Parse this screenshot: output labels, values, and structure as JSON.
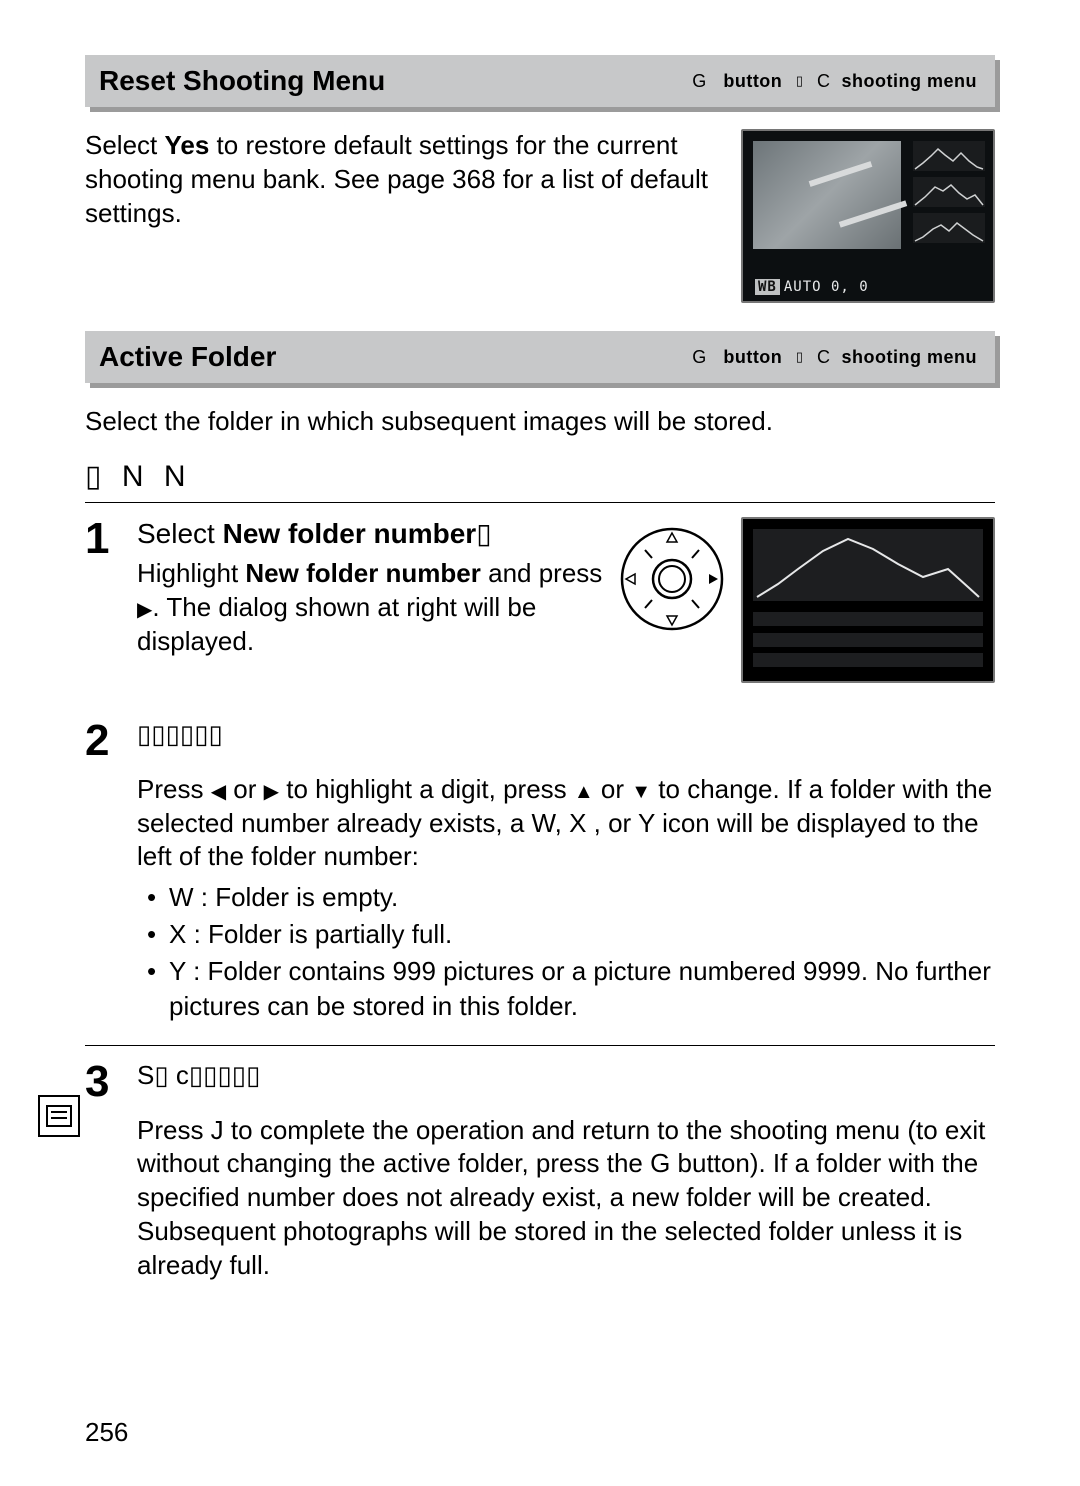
{
  "bar1": {
    "title": "Reset Shooting Menu",
    "crumb_button_glyph": "G",
    "crumb_button_word": "button",
    "crumb_menu_glyph": "C",
    "crumb_menu_word": "shooting menu"
  },
  "reset_desc": {
    "pre": "Select ",
    "yes": "Yes",
    "post": " to restore default settings for the current shooting menu bank.  See page 368 for a list of default settings."
  },
  "thumb1_caption_wb": "WB",
  "thumb1_caption_rest": "AUTO  0,  0",
  "bar2": {
    "title": "Active Folder",
    "crumb_button_glyph": "G",
    "crumb_button_word": "button",
    "crumb_menu_glyph": "C",
    "crumb_menu_word": "shooting menu"
  },
  "active_desc": "Select the folder in which subsequent images will be stored.",
  "nn_line": "▯  N   N",
  "step1": {
    "num": "1",
    "heading_pre": "Select ",
    "heading_bold": " New folder number",
    "heading_post": "▯",
    "sub_pre": "Highlight ",
    "sub_bold": "New folder number",
    "sub_mid": " and press ",
    "sub_post": ".  The dialog shown at right will be displayed."
  },
  "step2": {
    "num": "2",
    "heading": "▯▯▯▯▯▯",
    "para_a": "Press ",
    "para_b": " or ",
    "para_c": " to highlight a digit, press ",
    "para_d": " or ",
    "para_e": " to change.  If a folder with the selected number already exists, a W, X , or Y icon will be displayed to the left of the folder number:",
    "li1": "W : Folder is empty.",
    "li2": "X  : Folder is partially full.",
    "li3": "Y  : Folder contains 999 pictures or a picture numbered 9999.  No further pictures can be stored in this folder."
  },
  "step3": {
    "num": "3",
    "heading": "S▯ c▯▯▯▯▯",
    "para_a": "Press J  to complete the operation and return to the shooting menu (to exit without changing the active folder, press the G button). If a folder with the specified number does not already exist, a new folder will be created. Subsequent photographs will be stored in the selected folder unless it is already full."
  },
  "page_number": "256"
}
